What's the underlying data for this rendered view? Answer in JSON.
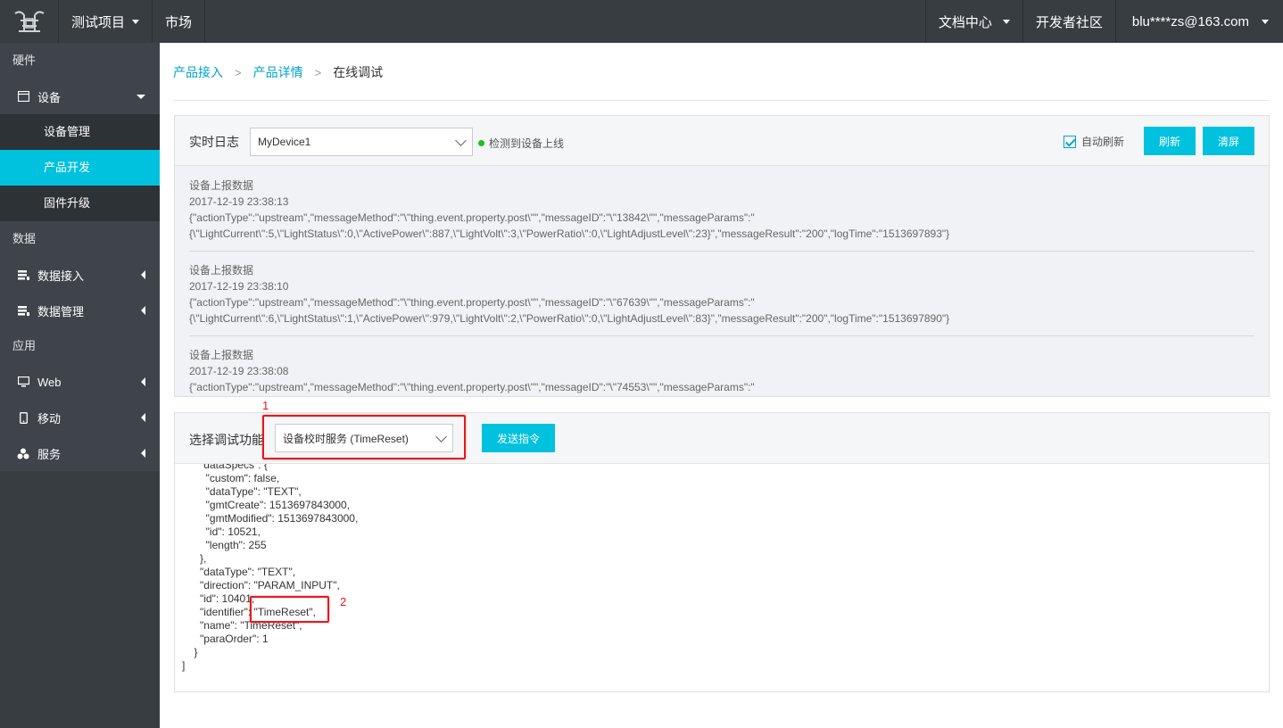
{
  "topbar": {
    "project": "测试项目",
    "market": "市场",
    "docs": "文档中心",
    "community": "开发者社区",
    "user": "blu****zs@163.com"
  },
  "sidebar": {
    "section_hardware": "硬件",
    "device": "设备",
    "device_manage": "设备管理",
    "product_dev": "产品开发",
    "firmware": "固件升级",
    "section_data": "数据",
    "data_access": "数据接入",
    "data_manage": "数据管理",
    "section_app": "应用",
    "web": "Web",
    "mobile": "移动",
    "service": "服务"
  },
  "breadcrumb": {
    "item1": "产品接入",
    "item2": "产品详情",
    "current": "在线调试",
    "sep": ">"
  },
  "log_panel": {
    "title": "实时日志",
    "device_select": "MyDevice1",
    "status": "检测到设备上线",
    "auto_refresh": "自动刷新",
    "refresh_btn": "刷新",
    "clear_btn": "清屏",
    "entries": [
      {
        "title": "设备上报数据",
        "time": "2017-12-19 23:38:13",
        "line1": "{\"actionType\":\"upstream\",\"messageMethod\":\"\\\"thing.event.property.post\\\"\",\"messageID\":\"\\\"13842\\\"\",\"messageParams\":\"",
        "line2": "{\\\"LightCurrent\\\":5,\\\"LightStatus\\\":0,\\\"ActivePower\\\":887,\\\"LightVolt\\\":3,\\\"PowerRatio\\\":0,\\\"LightAdjustLevel\\\":23}\",\"messageResult\":\"200\",\"logTime\":\"1513697893\"}"
      },
      {
        "title": "设备上报数据",
        "time": "2017-12-19 23:38:10",
        "line1": "{\"actionType\":\"upstream\",\"messageMethod\":\"\\\"thing.event.property.post\\\"\",\"messageID\":\"\\\"67639\\\"\",\"messageParams\":\"",
        "line2": "{\\\"LightCurrent\\\":6,\\\"LightStatus\\\":1,\\\"ActivePower\\\":979,\\\"LightVolt\\\":2,\\\"PowerRatio\\\":0,\\\"LightAdjustLevel\\\":83}\",\"messageResult\":\"200\",\"logTime\":\"1513697890\"}"
      },
      {
        "title": "设备上报数据",
        "time": "2017-12-19 23:38:08",
        "line1": "{\"actionType\":\"upstream\",\"messageMethod\":\"\\\"thing.event.property.post\\\"\",\"messageID\":\"\\\"74553\\\"\",\"messageParams\":\"",
        "line2": ""
      }
    ]
  },
  "debug_panel": {
    "title": "选择调试功能",
    "function_select": "设备校时服务 (TimeReset)",
    "send_btn": "发送指令",
    "anno1": "1",
    "anno2": "2",
    "code": "      \"dataSpecs\": {\n        \"custom\": false,\n        \"dataType\": \"TEXT\",\n        \"gmtCreate\": 1513697843000,\n        \"gmtModified\": 1513697843000,\n        \"id\": 10521,\n        \"length\": 255\n      },\n      \"dataType\": \"TEXT\",\n      \"direction\": \"PARAM_INPUT\",\n      \"id\": 10401,\n      \"identifier\": \"TimeReset\",\n      \"name\": \"TimeReset\",\n      \"paraOrder\": 1\n    }\n]"
  }
}
